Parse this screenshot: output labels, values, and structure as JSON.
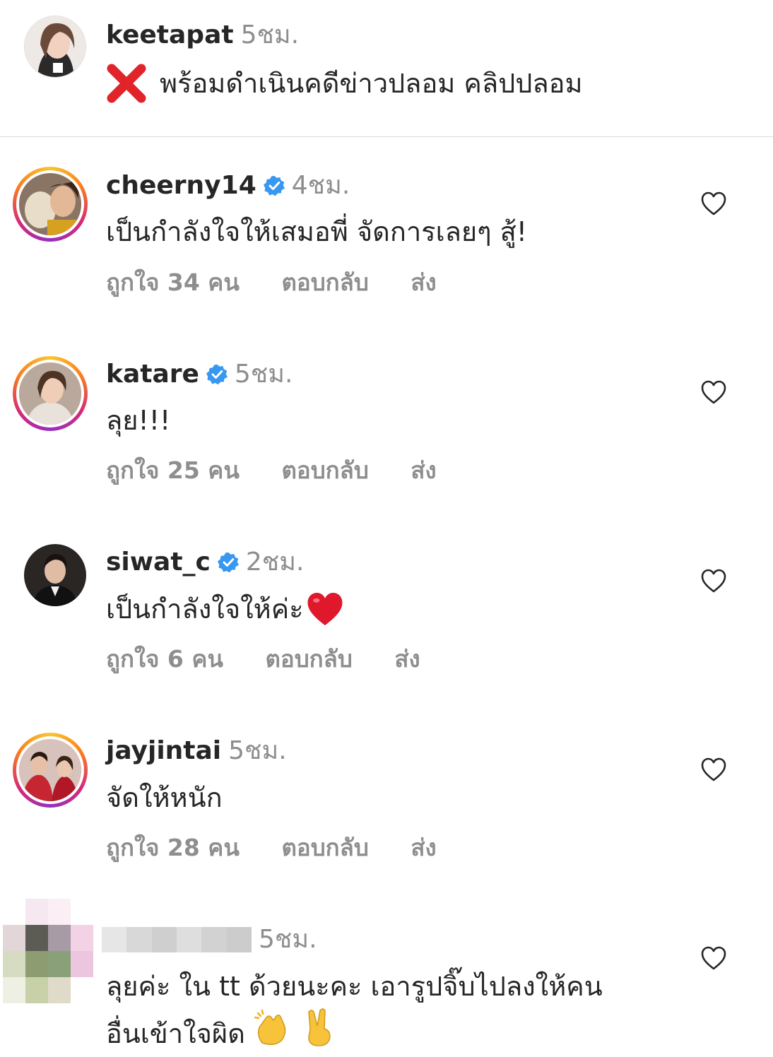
{
  "caption": {
    "username": "keetapat",
    "time": "5ชม.",
    "icon": "cross-mark-icon",
    "text": "พร้อมดำเนินคดีข่าวปลอม คลิปปลอม"
  },
  "comments": [
    {
      "username": "cheerny14",
      "verified": true,
      "time": "4ชม.",
      "text": "เป็นกำลังใจให้เสมอพี่ จัดการเลยๆ สู้!",
      "likes": "ถูกใจ 34 คน",
      "reply": "ตอบกลับ",
      "send": "ส่ง"
    },
    {
      "username": "katare",
      "verified": true,
      "time": "5ชม.",
      "text": "ลุย!!!",
      "likes": "ถูกใจ 25 คน",
      "reply": "ตอบกลับ",
      "send": "ส่ง"
    },
    {
      "username": "siwat_c",
      "verified": true,
      "time": "2ชม.",
      "text": "เป็นกำลังใจให้ค่ะ",
      "emoji": "❤️",
      "likes": "ถูกใจ 6 คน",
      "reply": "ตอบกลับ",
      "send": "ส่ง"
    },
    {
      "username": "jayjintai",
      "verified": false,
      "time": "5ชม.",
      "text": "จัดให้หนัก",
      "likes": "ถูกใจ 28 คน",
      "reply": "ตอบกลับ",
      "send": "ส่ง"
    },
    {
      "username": "",
      "username_censored": true,
      "verified": false,
      "time": "5ชม.",
      "text_line1": "ลุยค่ะ ใน tt ด้วยนะคะ เอารูปจิ๊บไปลงให้คน",
      "text_line2": "อื่นเข้าใจผิด",
      "emoji": "👏 ✌️"
    }
  ],
  "colors": {
    "text": "#262626",
    "secondary": "#8e8e8e",
    "verified": "#3897f0",
    "divider": "#dbdbdb"
  }
}
